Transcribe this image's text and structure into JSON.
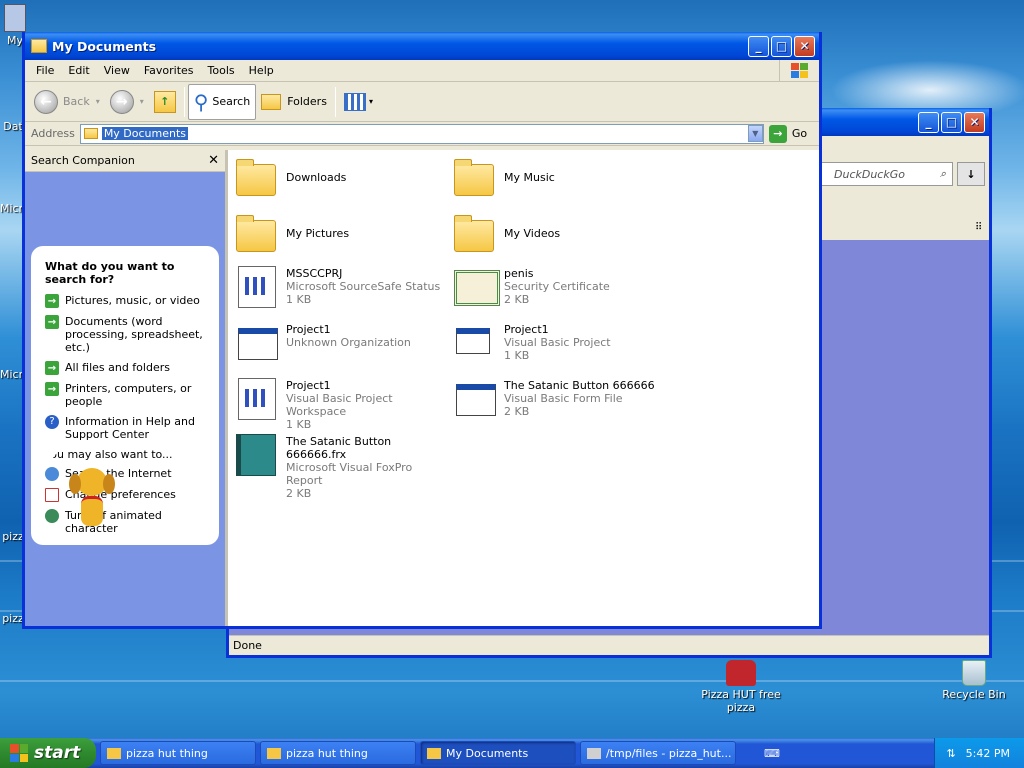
{
  "desktop": {
    "icons": [
      {
        "label": "My"
      },
      {
        "label": "Dat"
      },
      {
        "label": "Micro"
      },
      {
        "label": "Micro"
      },
      {
        "label": "pizz"
      },
      {
        "label": "pizz"
      }
    ],
    "pizza_icon_label": "Pizza HUT free pizza",
    "recycle_label": "Recycle Bin"
  },
  "browser_window": {
    "search_text": "DuckDuckGo"
  },
  "explorer": {
    "title": "My Documents",
    "menu": [
      "File",
      "Edit",
      "View",
      "Favorites",
      "Tools",
      "Help"
    ],
    "toolbar": {
      "back": "Back",
      "search": "Search",
      "folders": "Folders"
    },
    "address": {
      "label": "Address",
      "value": "My Documents",
      "go": "Go"
    },
    "companion": {
      "header": "Search Companion",
      "question": "What do you want to search for?",
      "options": [
        "Pictures, music, or video",
        "Documents (word processing, spreadsheet, etc.)",
        "All files and folders",
        "Printers, computers, or people",
        "Information in Help and Support Center"
      ],
      "also_label": "You may also want to...",
      "also_options": [
        "Search the Internet",
        "Change preferences",
        "Turn off animated character"
      ]
    },
    "files": [
      {
        "name": "Downloads",
        "type": "",
        "size": ""
      },
      {
        "name": "My Music",
        "type": "",
        "size": ""
      },
      {
        "name": "My Pictures",
        "type": "",
        "size": ""
      },
      {
        "name": "My Videos",
        "type": "",
        "size": ""
      },
      {
        "name": "MSSCCPRJ",
        "type": "Microsoft SourceSafe Status",
        "size": "1 KB"
      },
      {
        "name": "penis",
        "type": "Security Certificate",
        "size": "2 KB"
      },
      {
        "name": "Project1",
        "type": "Unknown Organization",
        "size": ""
      },
      {
        "name": "Project1",
        "type": "Visual Basic Project",
        "size": "1 KB"
      },
      {
        "name": "Project1",
        "type": "Visual Basic Project Workspace",
        "size": "1 KB"
      },
      {
        "name": "The Satanic Button 666666",
        "type": "Visual Basic Form File",
        "size": "2 KB"
      },
      {
        "name": "The Satanic Button 666666.frx",
        "type": "Microsoft Visual FoxPro Report",
        "size": "2 KB"
      }
    ]
  },
  "status": "Done",
  "taskbar": {
    "start": "start",
    "tasks": [
      "pizza hut thing",
      "pizza hut thing",
      "My Documents",
      "/tmp/files - pizza_hut..."
    ],
    "clock": "5:42 PM"
  },
  "colors": {
    "title_blue": "#0058e6",
    "companion_bg": "#7c94e4",
    "start_green": "#2f8a2f"
  }
}
